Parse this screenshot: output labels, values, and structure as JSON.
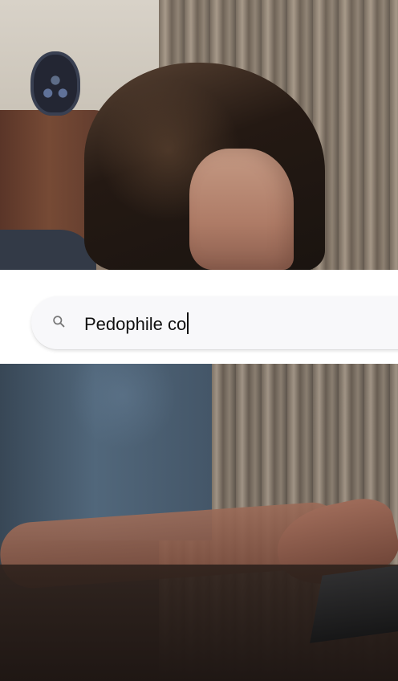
{
  "search": {
    "query": "Pedophile co",
    "icon": "search-icon"
  },
  "colors": {
    "search_band": "#ffffff",
    "search_pill": "#f8f8fa",
    "text": "#111111",
    "icon": "#777777"
  }
}
